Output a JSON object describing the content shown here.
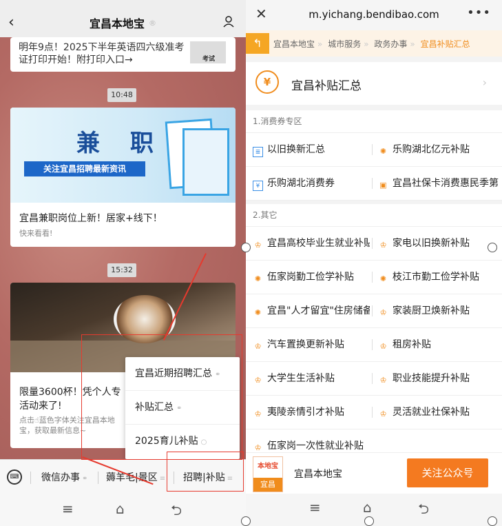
{
  "left": {
    "nav": {
      "title": "宜昌本地宝"
    },
    "card1": {
      "text": "明年9点！2025下半年英语四六级准考证打印开始！附打印入口→",
      "tag": "考试"
    },
    "time1": "10:48",
    "card2": {
      "headline": "兼 职",
      "banner": "关注宜昌招聘最新资讯",
      "title": "宜昌兼职岗位上新！居家+线下！",
      "subtitle": "快来看看!"
    },
    "time2": "15:32",
    "card3": {
      "title_line1": "限量3600杯！凭个人专",
      "title_line2": "活动来了!",
      "subtitle": "点击☝蓝色字体关注宜昌本地宝，获取最新信息~"
    },
    "popup": {
      "items": [
        "宜昌近期招聘汇总",
        "补贴汇总",
        "2025育儿补贴"
      ]
    },
    "menu": {
      "items": [
        "微信办事",
        "薅羊毛|景区",
        "招聘|补贴"
      ]
    }
  },
  "right": {
    "url": "m.yichang.bendibao.com",
    "crumbs": [
      "宜昌本地宝",
      "城市服务",
      "政务办事",
      "宜昌补贴汇总"
    ],
    "header": {
      "title": "宜昌补贴汇总"
    },
    "section1": {
      "title": "1.消费券专区",
      "rows": [
        {
          "left": "以旧换新汇总",
          "right": "乐购湖北亿元补贴"
        },
        {
          "left": "乐购湖北消费券",
          "right": "宜昌社保卡消费惠民季第"
        }
      ]
    },
    "section2": {
      "title": "2.其它",
      "rows": [
        {
          "left": "宜昌高校毕业生就业补贴",
          "right": "家电以旧换新补贴"
        },
        {
          "left": "伍家岗勤工俭学补贴",
          "right": "枝江市勤工俭学补贴"
        },
        {
          "left": "宜昌\"人才留宜\"住房储备",
          "right": "家装厨卫焕新补贴"
        },
        {
          "left": "汽车置换更新补贴",
          "right": "租房补贴"
        },
        {
          "left": "大学生生活补贴",
          "right": "职业技能提升补贴"
        },
        {
          "left": "夷陵亲情引才补贴",
          "right": "灵活就业社保补贴"
        },
        {
          "left": "伍家岗一次性就业补贴",
          "right": ""
        }
      ]
    },
    "footer": {
      "logo_top": "本地宝",
      "logo_bottom": "宜昌",
      "name": "宜昌本地宝",
      "follow": "关注公众号"
    }
  }
}
